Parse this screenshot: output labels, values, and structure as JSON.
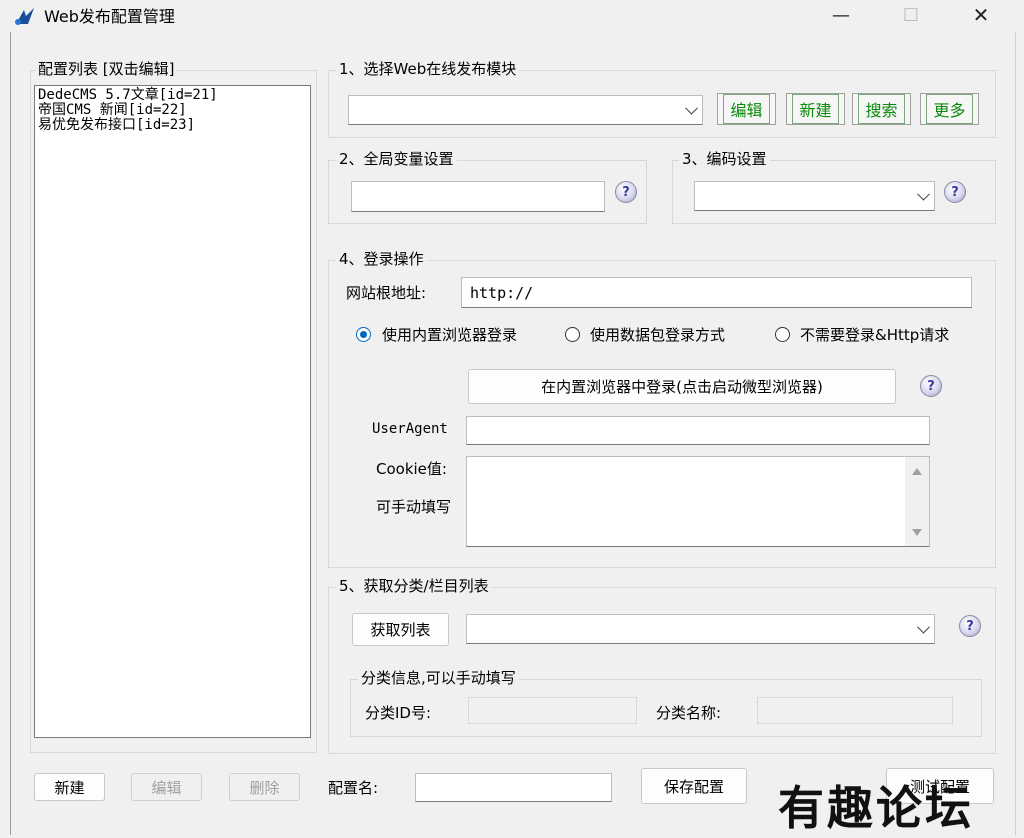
{
  "window": {
    "title": "Web发布配置管理",
    "controls": [
      "—",
      "☐",
      "✕"
    ]
  },
  "config_list": {
    "title": "配置列表 [双击编辑]",
    "items": [
      "DedeCMS 5.7文章[id=21]",
      "帝国CMS 新闻[id=22]",
      "易优免发布接口[id=23]"
    ]
  },
  "bottom_bar": {
    "new_label": "新建",
    "edit_label": "编辑",
    "delete_label": "删除",
    "config_name_label": "配置名:",
    "config_name_value": "",
    "save_label": "保存配置",
    "test_label": "测试配置"
  },
  "section1": {
    "title": "1、选择Web在线发布模块",
    "module_value": "",
    "edit": "编辑",
    "new": "新建",
    "search": "搜索",
    "more": "更多"
  },
  "section2": {
    "title": "2、全局变量设置",
    "value": ""
  },
  "section3": {
    "title": "3、编码设置",
    "value": ""
  },
  "section4": {
    "title": "4、登录操作",
    "root_label": "网站根地址:",
    "root_value": "http://",
    "radio_options": [
      "使用内置浏览器登录",
      "使用数据包登录方式",
      "不需要登录&Http请求"
    ],
    "radio_selected": 0,
    "browser_login_button": "在内置浏览器中登录(点击启动微型浏览器)",
    "useragent_label": "UserAgent",
    "useragent_value": "",
    "cookie_label": "Cookie值:",
    "cookie_hint": "可手动填写",
    "cookie_value": ""
  },
  "section5": {
    "title": "5、获取分类/栏目列表",
    "fetch_button": "获取列表",
    "list_value": "",
    "category_group_title": "分类信息,可以手动填写",
    "category_id_label": "分类ID号:",
    "category_id_value": "",
    "category_name_label": "分类名称:",
    "category_name_value": ""
  },
  "help_icon_glyph": "?",
  "watermark": "有趣论坛"
}
